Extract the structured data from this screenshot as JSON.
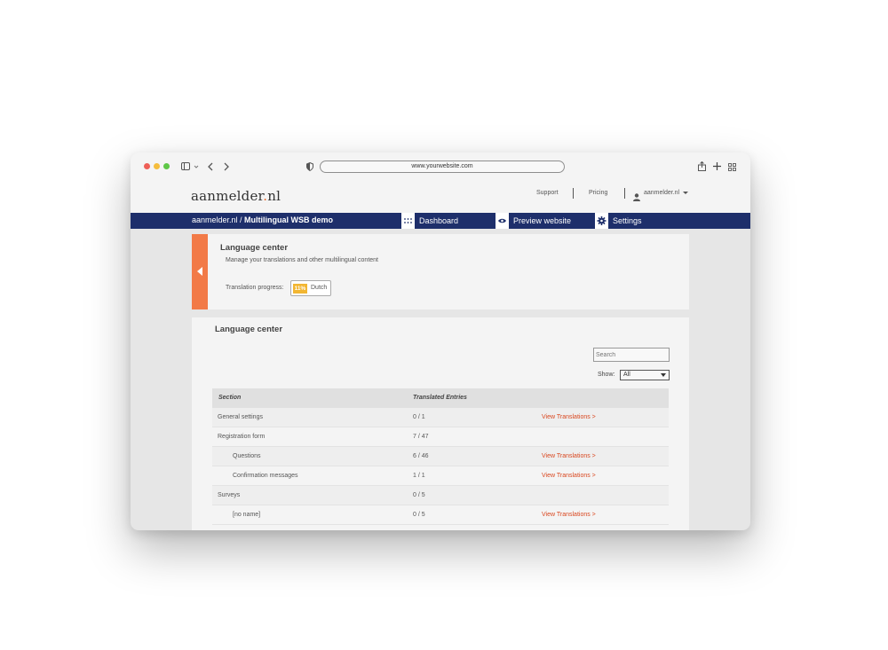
{
  "browser": {
    "url": "www.yourwebsite.com"
  },
  "site": {
    "logo": "aanmelder",
    "logo_dot": ".",
    "logo_tld": "nl",
    "links": {
      "support": "Support",
      "pricing": "Pricing",
      "account": "aanmelder.nl"
    }
  },
  "navbar": {
    "breadcrumb_root": "aanmelder.nl / ",
    "breadcrumb_current": "Multilingual WSB demo",
    "items": [
      {
        "label": "Dashboard"
      },
      {
        "label": "Preview website"
      },
      {
        "label": "Settings"
      }
    ]
  },
  "banner": {
    "title": "Language center",
    "subtitle": "Manage your translations and other multilingual content",
    "progress_label": "Translation progress:",
    "progress_percent": "11%",
    "progress_language": "Dutch"
  },
  "panel": {
    "title": "Language center",
    "search_placeholder": "Search",
    "show_label": "Show:",
    "show_value": "All",
    "columns": [
      "Section",
      "Translated Entries"
    ],
    "rows": [
      {
        "section": "General settings",
        "entries": "0 / 1",
        "link": "View Translations >",
        "indent": false
      },
      {
        "section": "Registration form",
        "entries": "7 / 47",
        "link": "",
        "indent": false
      },
      {
        "section": "Questions",
        "entries": "6 / 46",
        "link": "View Translations >",
        "indent": true
      },
      {
        "section": "Confirmation messages",
        "entries": "1 / 1",
        "link": "View Translations >",
        "indent": true
      },
      {
        "section": "Surveys",
        "entries": "0 / 5",
        "link": "",
        "indent": false
      },
      {
        "section": "[no name]",
        "entries": "0 / 5",
        "link": "View Translations >",
        "indent": true
      }
    ]
  },
  "colors": {
    "navbar": "#1e2f6b",
    "accent": "#f27a47",
    "progress": "#f2b632",
    "link": "#d9471f"
  }
}
